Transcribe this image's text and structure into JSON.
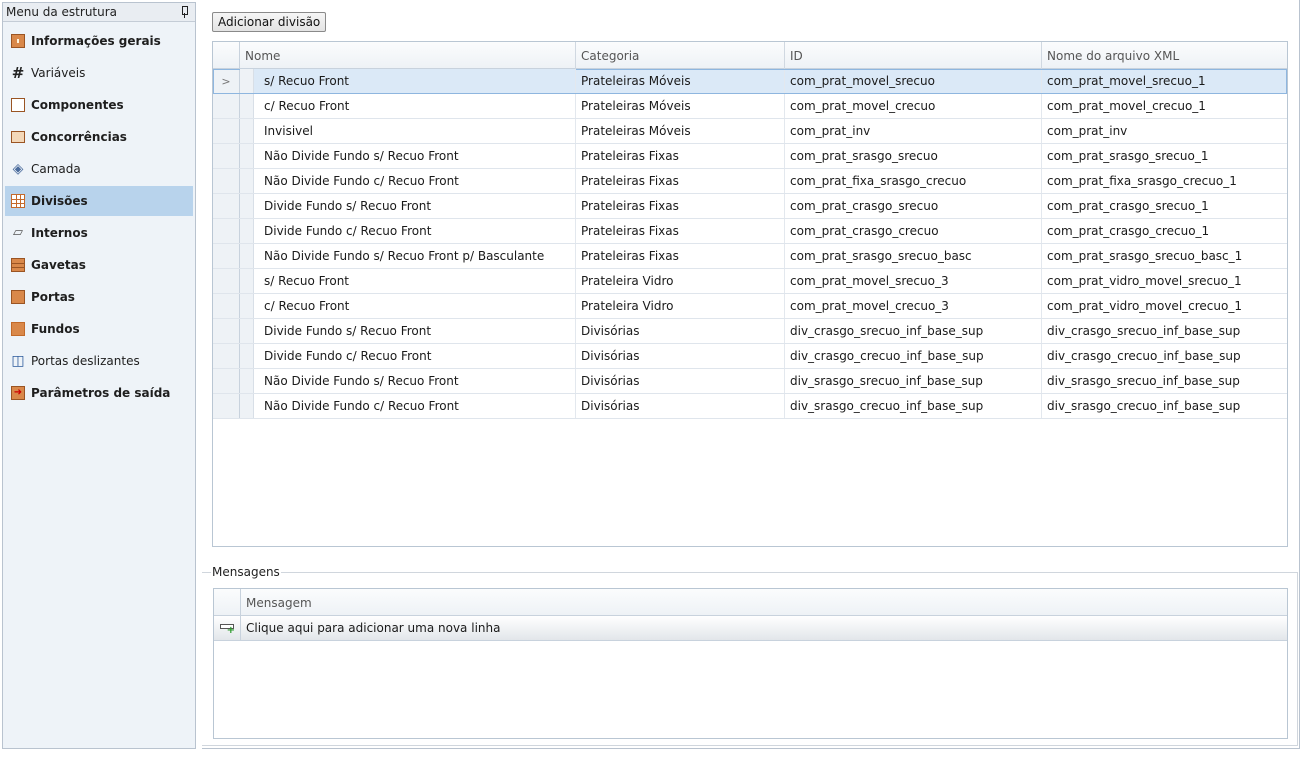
{
  "sidebar": {
    "title": "Menu da estrutura",
    "items": [
      {
        "label": "Informações gerais",
        "icon": "cabinet-icon",
        "bold": true,
        "active": false
      },
      {
        "label": "Variáveis",
        "icon": "hash-icon",
        "bold": false,
        "active": false
      },
      {
        "label": "Componentes",
        "icon": "panel-icon",
        "bold": true,
        "active": false
      },
      {
        "label": "Concorrências",
        "icon": "small-part-icon",
        "bold": true,
        "active": false
      },
      {
        "label": "Camada",
        "icon": "layer-icon",
        "bold": false,
        "active": false
      },
      {
        "label": "Divisões",
        "icon": "grid-icon",
        "bold": true,
        "active": true
      },
      {
        "label": "Internos",
        "icon": "shelf-icon",
        "bold": true,
        "active": false
      },
      {
        "label": "Gavetas",
        "icon": "drawer-icon",
        "bold": true,
        "active": false
      },
      {
        "label": "Portas",
        "icon": "door-icon",
        "bold": true,
        "active": false
      },
      {
        "label": "Fundos",
        "icon": "back-panel-icon",
        "bold": true,
        "active": false
      },
      {
        "label": "Portas deslizantes",
        "icon": "sliding-door-icon",
        "bold": false,
        "active": false
      },
      {
        "label": "Parâmetros de saída",
        "icon": "output-icon",
        "bold": true,
        "active": false
      }
    ]
  },
  "toolbar": {
    "add_button": "Adicionar divisão"
  },
  "grid": {
    "columns": [
      "Nome",
      "Categoria",
      "ID",
      "Nome do arquivo XML"
    ],
    "selected_indicator": ">",
    "rows": [
      [
        "s/ Recuo Front",
        "Prateleiras Móveis",
        "com_prat_movel_srecuo",
        "com_prat_movel_srecuo_1"
      ],
      [
        "c/ Recuo Front",
        "Prateleiras Móveis",
        "com_prat_movel_crecuo",
        "com_prat_movel_crecuo_1"
      ],
      [
        "Invisivel",
        "Prateleiras Móveis",
        "com_prat_inv",
        "com_prat_inv"
      ],
      [
        "Não Divide Fundo s/ Recuo Front",
        "Prateleiras Fixas",
        "com_prat_srasgo_srecuo",
        "com_prat_srasgo_srecuo_1"
      ],
      [
        "Não Divide Fundo c/ Recuo Front",
        "Prateleiras Fixas",
        "com_prat_fixa_srasgo_crecuo",
        "com_prat_fixa_srasgo_crecuo_1"
      ],
      [
        "Divide Fundo s/ Recuo Front",
        "Prateleiras Fixas",
        "com_prat_crasgo_srecuo",
        "com_prat_crasgo_srecuo_1"
      ],
      [
        "Divide Fundo c/ Recuo Front",
        "Prateleiras Fixas",
        "com_prat_crasgo_crecuo",
        "com_prat_crasgo_crecuo_1"
      ],
      [
        "Não Divide Fundo s/ Recuo Front p/ Basculante",
        "Prateleiras Fixas",
        "com_prat_srasgo_srecuo_basc",
        "com_prat_srasgo_srecuo_basc_1"
      ],
      [
        "s/ Recuo Front",
        "Prateleira Vidro",
        "com_prat_movel_srecuo_3",
        "com_prat_vidro_movel_srecuo_1"
      ],
      [
        "c/ Recuo Front",
        "Prateleira Vidro",
        "com_prat_movel_crecuo_3",
        "com_prat_vidro_movel_crecuo_1"
      ],
      [
        "Divide Fundo s/ Recuo Front",
        "Divisórias",
        "div_crasgo_srecuo_inf_base_sup",
        "div_crasgo_srecuo_inf_base_sup"
      ],
      [
        "Divide Fundo c/ Recuo Front",
        "Divisórias",
        "div_crasgo_crecuo_inf_base_sup",
        "div_crasgo_crecuo_inf_base_sup"
      ],
      [
        "Não Divide Fundo s/ Recuo Front",
        "Divisórias",
        "div_srasgo_srecuo_inf_base_sup",
        "div_srasgo_srecuo_inf_base_sup"
      ],
      [
        "Não Divide Fundo c/ Recuo Front",
        "Divisórias",
        "div_srasgo_crecuo_inf_base_sup",
        "div_srasgo_crecuo_inf_base_sup"
      ]
    ]
  },
  "messages": {
    "group_label": "Mensagens",
    "column": "Mensagem",
    "new_row_text": "Clique aqui para adicionar uma nova linha"
  }
}
